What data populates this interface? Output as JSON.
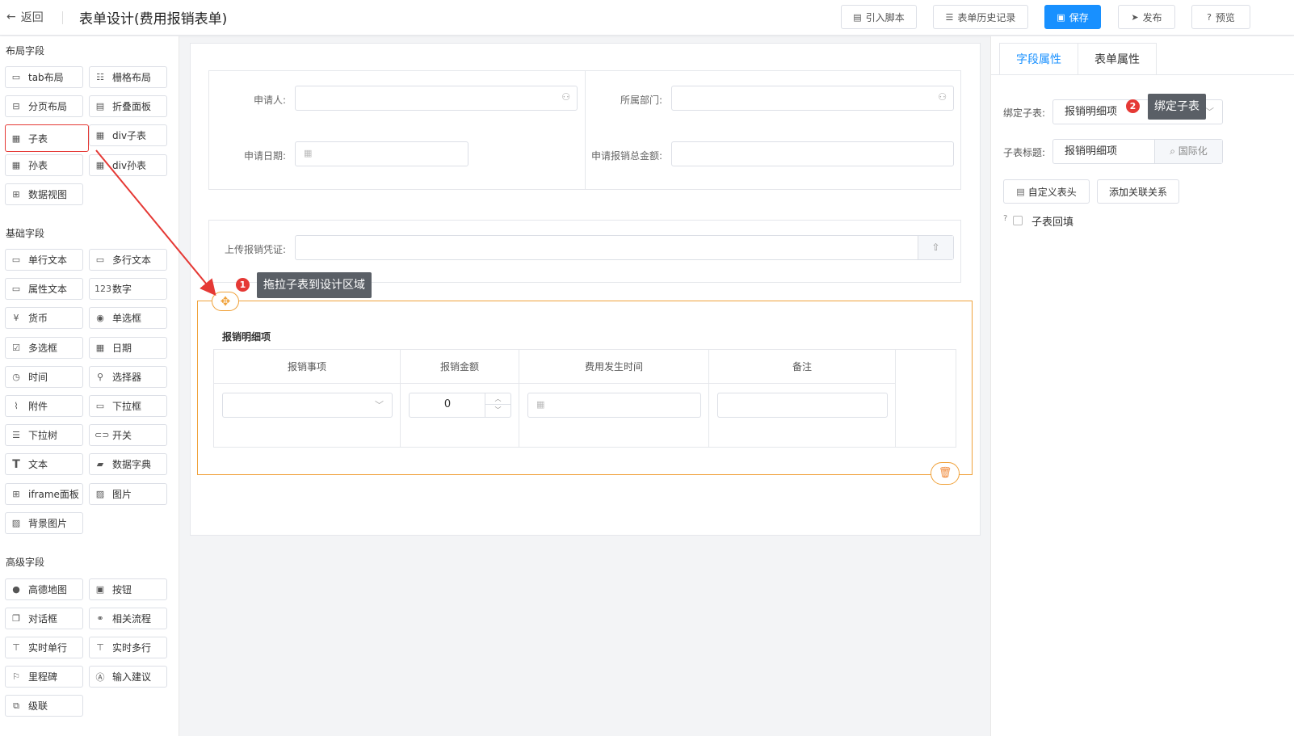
{
  "header": {
    "back_label": "返回",
    "title": "表单设计(费用报销表单)",
    "buttons": {
      "script": "引入脚本",
      "history": "表单历史记录",
      "save": "保存",
      "publish": "发布",
      "preview": "预览"
    }
  },
  "palette": {
    "layout_title": "布局字段",
    "layout_items": [
      "tab布局",
      "栅格布局",
      "分页布局",
      "折叠面板",
      "子表",
      "div子表",
      "孙表",
      "div孙表",
      "数据视图"
    ],
    "basic_title": "基础字段",
    "basic_items": [
      "单行文本",
      "多行文本",
      "属性文本",
      "数字",
      "货币",
      "单选框",
      "多选框",
      "日期",
      "时间",
      "选择器",
      "附件",
      "下拉框",
      "下拉树",
      "开关",
      "文本",
      "数据字典",
      "iframe面板",
      "图片",
      "背景图片"
    ],
    "advanced_title": "高级字段",
    "advanced_items": [
      "高德地图",
      "按钮",
      "对话框",
      "相关流程",
      "实时单行",
      "实时多行",
      "里程碑",
      "输入建议",
      "级联"
    ]
  },
  "form": {
    "applicant_label": "申请人:",
    "department_label": "所属部门:",
    "date_label": "申请日期:",
    "total_label": "申请报销总金额:",
    "upload_label": "上传报销凭证:"
  },
  "subtable": {
    "title": "报销明细项",
    "columns": [
      "报销事项",
      "报销金额",
      "费用发生时间",
      "备注"
    ],
    "amount_value": "0"
  },
  "annotations": {
    "step1_badge": "1",
    "step1_text": "拖拉子表到设计区域",
    "step2_badge": "2",
    "step2_text": "绑定子表"
  },
  "props": {
    "tabs": [
      "字段属性",
      "表单属性"
    ],
    "bind_label": "绑定子表:",
    "bind_value": "报销明细项",
    "title_label": "子表标题:",
    "title_value": "报销明细项",
    "i18n_label": "国际化",
    "custom_header_btn": "自定义表头",
    "add_relation_btn": "添加关联关系",
    "backfill_label": "子表回填"
  },
  "colors": {
    "primary": "#1890ff",
    "highlight": "#f0a23b",
    "annotation": "#e53935"
  }
}
